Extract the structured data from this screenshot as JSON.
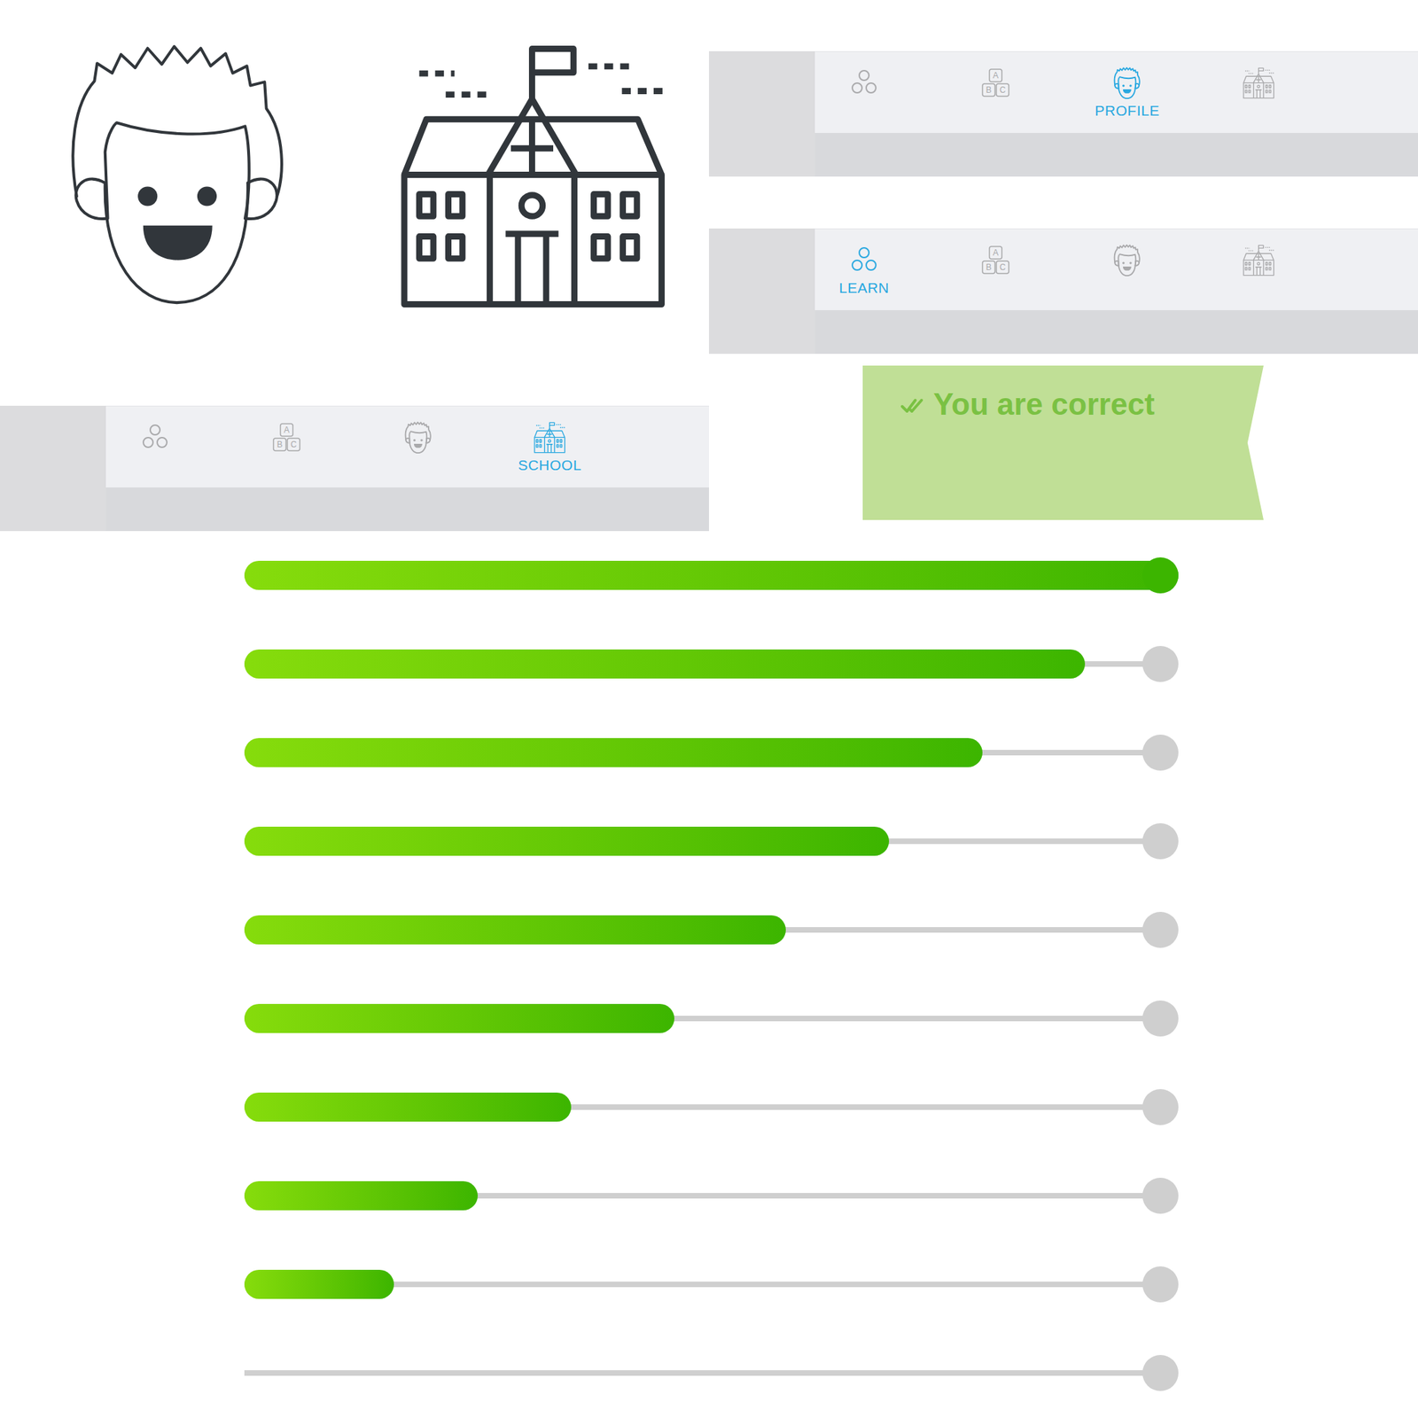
{
  "nav_bars": [
    {
      "tabs": [
        {
          "kind": "learn",
          "selected": false
        },
        {
          "kind": "abc",
          "letters": [
            "A",
            "B",
            "C"
          ],
          "selected": false
        },
        {
          "kind": "profile",
          "label": "PROFILE",
          "selected": true
        },
        {
          "kind": "school",
          "selected": false
        }
      ]
    },
    {
      "tabs": [
        {
          "kind": "learn",
          "label": "LEARN",
          "selected": true
        },
        {
          "kind": "abc",
          "letters": [
            "A",
            "B",
            "C"
          ],
          "selected": false
        },
        {
          "kind": "profile",
          "selected": false
        },
        {
          "kind": "school",
          "selected": false
        }
      ]
    },
    {
      "tabs": [
        {
          "kind": "learn",
          "selected": false
        },
        {
          "kind": "abc",
          "letters": [
            "A",
            "B",
            "C"
          ],
          "selected": false
        },
        {
          "kind": "profile",
          "selected": false
        },
        {
          "kind": "school",
          "label": "SCHOOL",
          "selected": true
        }
      ]
    }
  ],
  "feedback": {
    "text": "You are correct",
    "correct": true
  },
  "progress_bars": [
    {
      "level": 1
    },
    {
      "level": 0.9
    },
    {
      "level": 0.79
    },
    {
      "level": 0.69
    },
    {
      "level": 0.58
    },
    {
      "level": 0.46
    },
    {
      "level": 0.35
    },
    {
      "level": 0.25
    },
    {
      "level": 0.16
    },
    {
      "level": 0
    }
  ]
}
